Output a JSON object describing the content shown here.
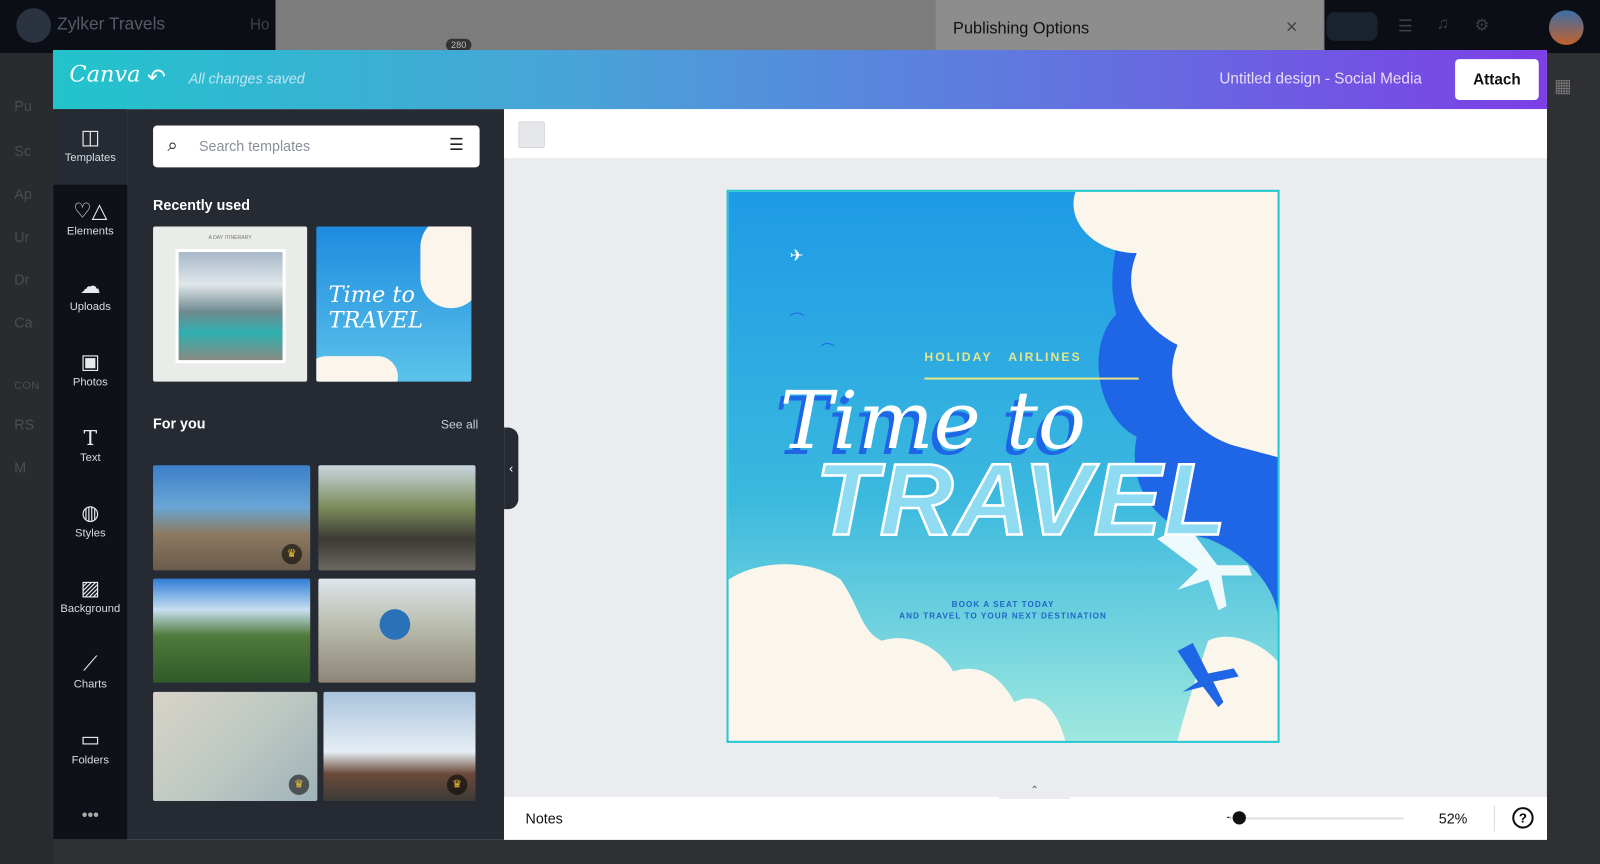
{
  "background_app": {
    "brand": "Zylker Travels",
    "nav_partial": "Ho",
    "badge": "280",
    "sidebar_partials": [
      "Pu",
      "Sc",
      "Ap",
      "Ur",
      "Dr",
      "Ca",
      "CON",
      "RS",
      "M"
    ]
  },
  "publishing": {
    "title": "Publishing Options",
    "close": "×"
  },
  "header": {
    "logo": "Canva",
    "status": "All changes saved",
    "design_title": "Untitled design - Social Media",
    "attach_label": "Attach"
  },
  "rail": [
    {
      "label": "Templates",
      "icon": "template-icon"
    },
    {
      "label": "Elements",
      "icon": "shapes-icon"
    },
    {
      "label": "Uploads",
      "icon": "cloud-upload-icon"
    },
    {
      "label": "Photos",
      "icon": "image-icon"
    },
    {
      "label": "Text",
      "icon": "text-icon"
    },
    {
      "label": "Styles",
      "icon": "palette-icon"
    },
    {
      "label": "Background",
      "icon": "stripes-icon"
    },
    {
      "label": "Charts",
      "icon": "chart-icon"
    },
    {
      "label": "Folders",
      "icon": "folder-icon"
    },
    {
      "label": "•••",
      "icon": "more-icon"
    }
  ],
  "panel": {
    "search_placeholder": "Search templates",
    "recently_used": "Recently used",
    "for_you": "For you",
    "see_all": "See all",
    "recent_thumb_texts": [
      "A DAY ITINERARY",
      "Time to TRAVEL"
    ],
    "crown": "♛"
  },
  "design": {
    "brand_line": "HOLIDAY   AIRLINES",
    "script": "Time to",
    "headline": "TRAVEL",
    "sub1": "BOOK A SEAT TODAY",
    "sub2": "AND TRAVEL TO YOUR NEXT DESTINATION"
  },
  "footer": {
    "notes": "Notes",
    "zoom": "52%",
    "zoom_fraction": 0.05,
    "help": "?"
  }
}
